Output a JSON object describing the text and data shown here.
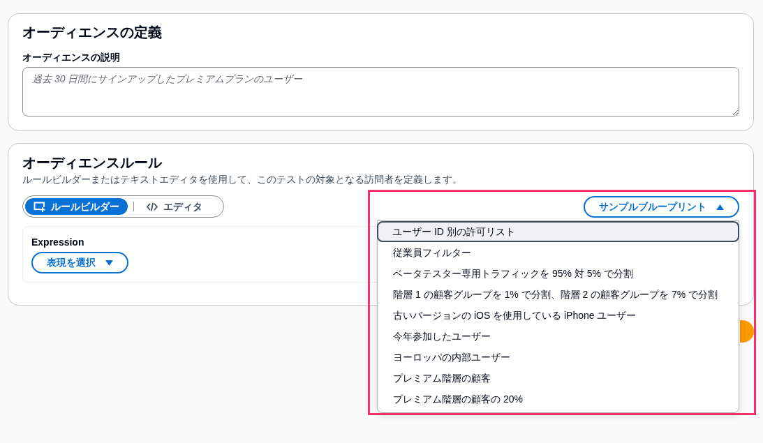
{
  "audience_definition": {
    "title": "オーディエンスの定義",
    "description": {
      "label": "オーディエンスの説明",
      "placeholder": "過去 30 日間にサインアップしたプレミアムプランのユーザー"
    }
  },
  "audience_rules": {
    "title": "オーディエンスルール",
    "subtitle": "ルールビルダーまたはテキストエディタを使用して、このテストの対象となる訪問者を定義します。",
    "mode_tabs": [
      {
        "label": "ルールビルダー",
        "kind": "builder",
        "selected": true
      },
      {
        "label": "エディタ",
        "kind": "code",
        "selected": false
      }
    ],
    "expression": {
      "label": "Expression",
      "button": "表現を選択"
    },
    "blueprints": {
      "button": "サンプルブループリント",
      "expanded": true,
      "items": [
        {
          "label": "ユーザー ID 別の許可リスト",
          "selected": true
        },
        {
          "label": "従業員フィルター",
          "selected": false
        },
        {
          "label": "ベータテスター専用トラフィックを 95% 対 5% で分割",
          "selected": false
        },
        {
          "label": "階層 1 の顧客グループを 1% で分割、階層 2 の顧客グループを 7% で分割",
          "selected": false
        },
        {
          "label": "古いバージョンの iOS を使用している iPhone ユーザー",
          "selected": false
        },
        {
          "label": "今年参加したユーザー",
          "selected": false
        },
        {
          "label": "ヨーロッパの内部ユーザー",
          "selected": false
        },
        {
          "label": "プレミアム階層の顧客",
          "selected": false
        },
        {
          "label": "プレミアム階層の顧客の 20%",
          "selected": false
        }
      ]
    }
  }
}
